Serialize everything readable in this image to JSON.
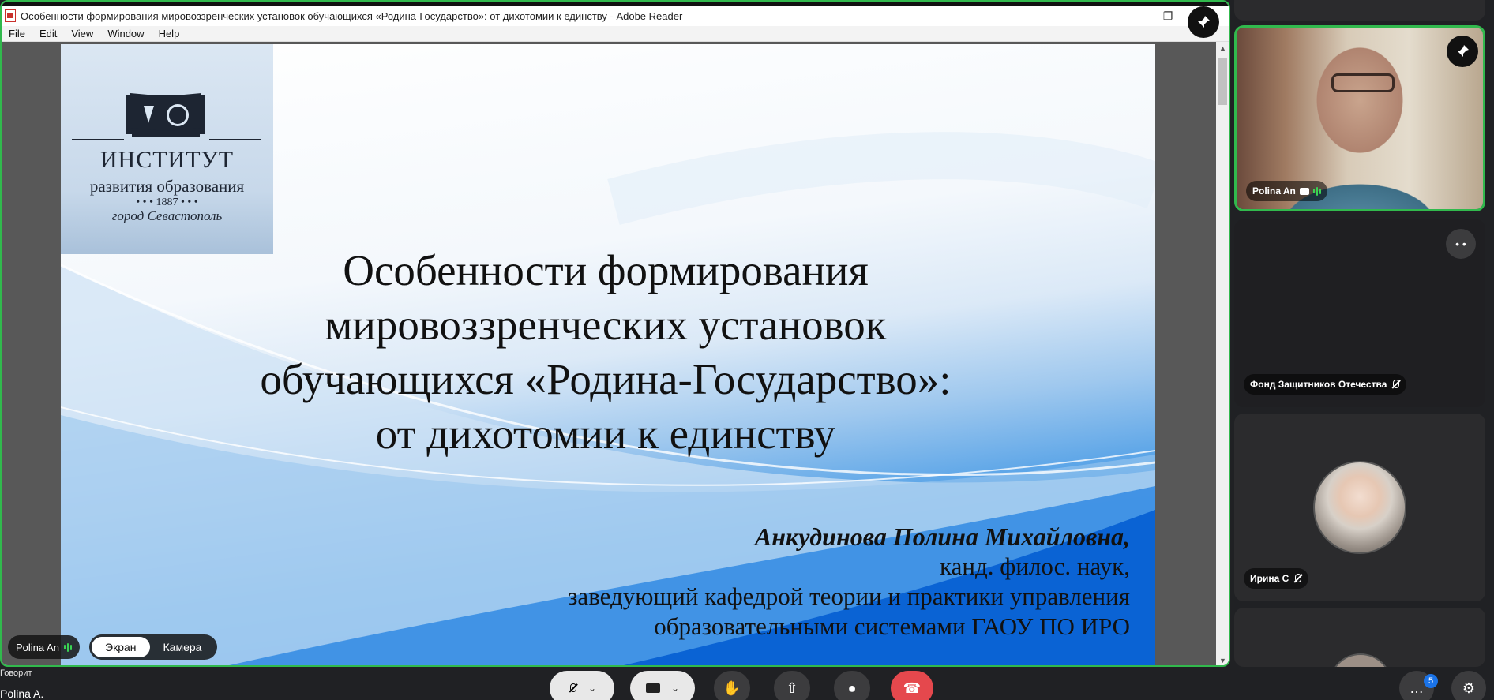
{
  "window": {
    "title": "Особенности формирования мировоззренческих установок обучающихся «Родина-Государство»: от дихотомии к единству - Adobe Reader",
    "minimize": "—",
    "restore": "❐"
  },
  "menu": [
    "File",
    "Edit",
    "View",
    "Window",
    "Help"
  ],
  "slide": {
    "logo": {
      "line1": "ИНСТИТУТ",
      "line2": "развития образования",
      "line3": "• • • 1887 • • •",
      "line4": "город Севастополь"
    },
    "title_lines": [
      "Особенности формирования",
      "мировоззренческих установок",
      "обучающихся «Родина-Государство»:",
      "от дихотомии к единству"
    ],
    "author_name": "Анкудинова Полина Михайловна,",
    "author_lines": [
      "канд. филос. наук,",
      "заведующий кафедрой теории и практики управления",
      "образовательными системами ГАОУ ПО ИРО"
    ]
  },
  "share_overlay": {
    "speaker": "Polina An",
    "toggle": {
      "screen": "Экран",
      "camera": "Камера",
      "active": "screen"
    }
  },
  "participants": [
    {
      "name": "Polina An",
      "video": true,
      "speaking": true
    },
    {
      "name": "Фонд Защитников Отечества",
      "video": false,
      "muted": true
    },
    {
      "name": "Ирина С",
      "video": false,
      "muted": true
    }
  ],
  "bottom": {
    "speaking_label": "Говорит",
    "speaking_name": "Polina A.",
    "chat_badge": "5"
  },
  "colors": {
    "active_border": "#31b94d",
    "leave": "#e5484d",
    "badge": "#1a73e8"
  }
}
